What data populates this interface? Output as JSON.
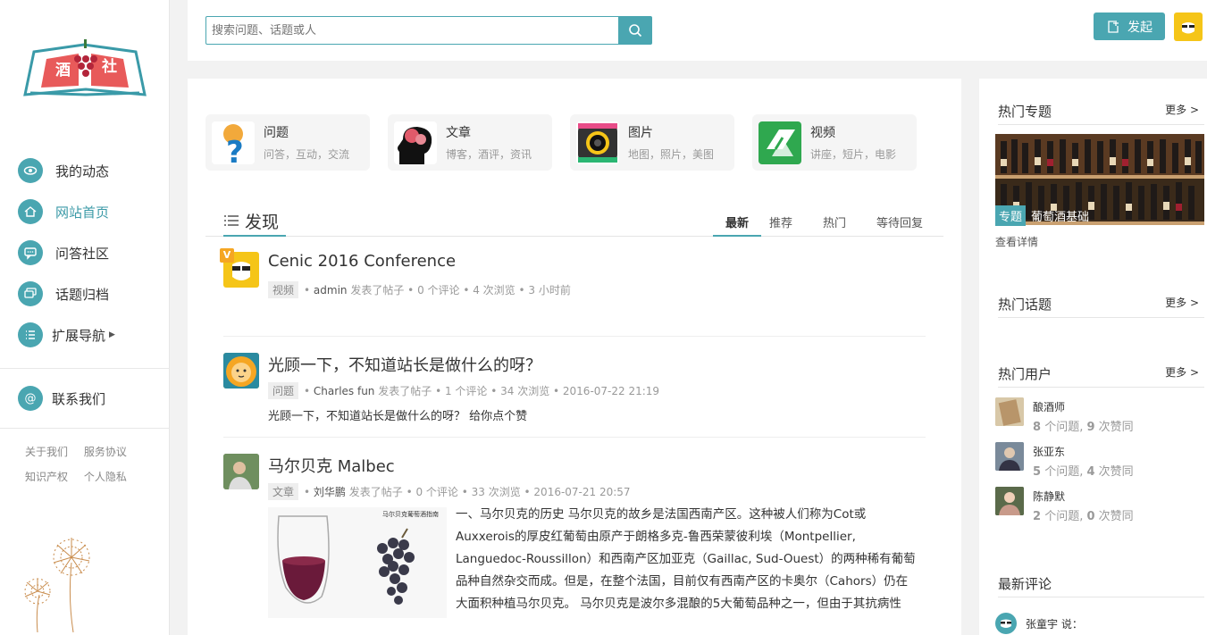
{
  "logo": {
    "left_char": "酒",
    "right_char": "社"
  },
  "sidebar": {
    "items": [
      {
        "label": "我的动态",
        "icon": "eye-icon"
      },
      {
        "label": "网站首页",
        "icon": "home-icon"
      },
      {
        "label": "问答社区",
        "icon": "chat-icon"
      },
      {
        "label": "话题归档",
        "icon": "comments-icon"
      },
      {
        "label": "扩展导航",
        "icon": "list-icon"
      }
    ],
    "contact": "联系我们",
    "footer_links": [
      "关于我们",
      "服务协议",
      "知识产权",
      "个人隐私"
    ]
  },
  "topbar": {
    "search_placeholder": "搜索问题、话题或人",
    "launch_label": "发起"
  },
  "categories": [
    {
      "title": "问题",
      "sub": "问答，互动，交流"
    },
    {
      "title": "文章",
      "sub": "博客，酒评，资讯"
    },
    {
      "title": "图片",
      "sub": "地图，照片，美图"
    },
    {
      "title": "视频",
      "sub": "讲座，短片，电影"
    }
  ],
  "discover": {
    "title": "发现",
    "tabs": [
      "最新",
      "推荐",
      "热门",
      "等待回复"
    ]
  },
  "posts": [
    {
      "title": "Cenic 2016 Conference",
      "type": "视频",
      "author": "admin",
      "meta": "发表了帖子 • 0 个评论 • 4 次浏览 • 3 小时前"
    },
    {
      "title": "光顾一下，不知道站长是做什么的呀？",
      "type": "问题",
      "author": "Charles fun",
      "meta": "发表了帖子 • 1 个评论 • 34 次浏览 • 2016-07-22 21:19",
      "body": "光顾一下，不知道站长是做什么的呀？ 给你点个赞"
    },
    {
      "title": "马尔贝克 Malbec",
      "type": "文章",
      "author": "刘华鹏",
      "meta": "发表了帖子 • 0 个评论 • 33 次浏览 • 2016-07-21 20:57",
      "body_lines": [
        "一、马尔贝克的历史   马尔贝克的故乡是法国西南产区。这种被人们称为Cot或",
        "Auxxerois的厚皮红葡萄由原产于朗格多克-鲁西荣蒙彼利埃（Montpellier,",
        "Languedoc-Roussillon）和西南产区加亚克（Gaillac, Sud-Ouest）的两种稀有葡萄",
        "品种自然杂交而成。但是，在整个法国，目前仅有西南产区的卡奥尔（Cahors）仍在",
        "大面积种植马尔贝克。   马尔贝克是波尔多混酿的5大葡萄品种之一，但由于其抗病性"
      ],
      "image_caption": "马尔贝克葡萄酒指南"
    }
  ],
  "right": {
    "more": "更多 >",
    "hot_topics": "热门专题",
    "topic_tag": "专题",
    "topic_name": "葡萄酒基础",
    "detail": "查看详情",
    "hot_subjects": "热门话题",
    "hot_users": "热门用户",
    "users": [
      {
        "name": "酿酒师",
        "questions": "8",
        "likes": "9"
      },
      {
        "name": "张亚东",
        "questions": "5",
        "likes": "4"
      },
      {
        "name": "陈静默",
        "questions": "2",
        "likes": "0"
      }
    ],
    "q_label": "个问题,",
    "like_label": "次赞同",
    "latest_comments": "最新评论",
    "comment_user": "张童宇 说："
  }
}
